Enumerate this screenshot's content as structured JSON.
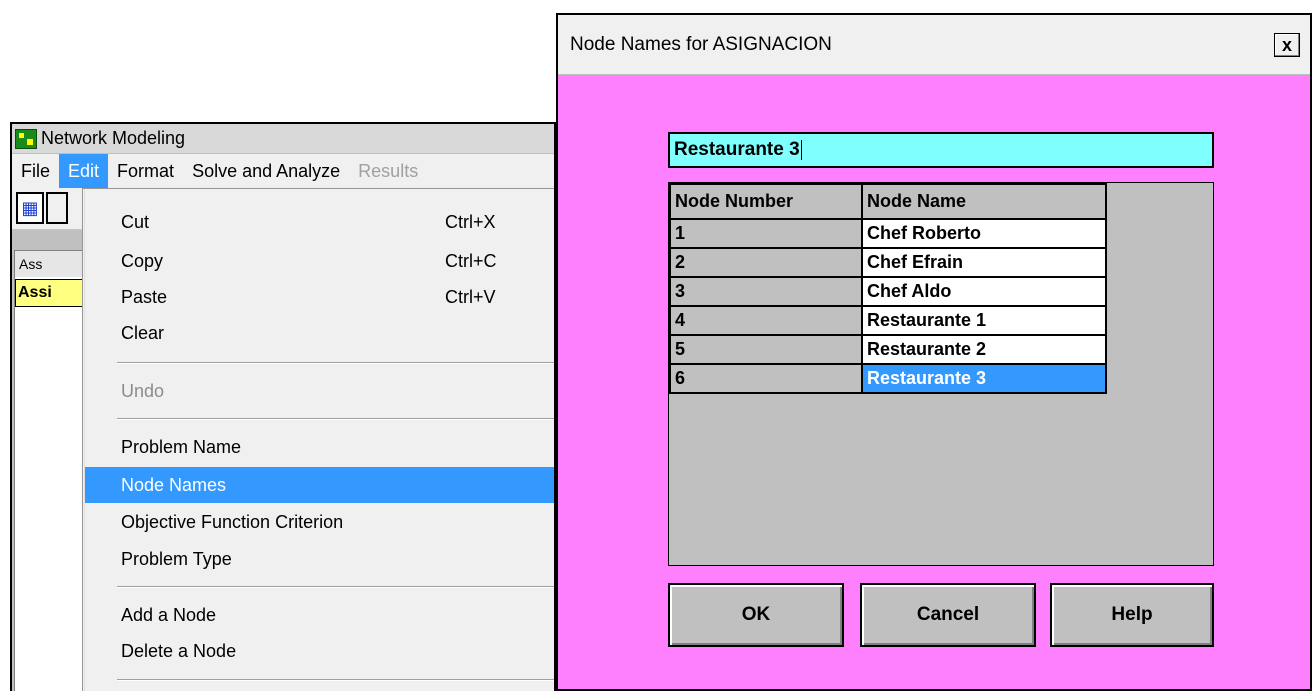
{
  "left_window": {
    "title": "Network Modeling",
    "menu": [
      "File",
      "Edit",
      "Format",
      "Solve and Analyze",
      "Results"
    ],
    "child_title": "Ass",
    "child_cell": "Assi"
  },
  "edit_menu": {
    "cut": {
      "label": "Cut",
      "shortcut": "Ctrl+X"
    },
    "copy": {
      "label": "Copy",
      "shortcut": "Ctrl+C"
    },
    "paste": {
      "label": "Paste",
      "shortcut": "Ctrl+V"
    },
    "clear": {
      "label": "Clear"
    },
    "undo": {
      "label": "Undo"
    },
    "problem_name": {
      "label": "Problem Name"
    },
    "node_names": {
      "label": "Node Names"
    },
    "objective": {
      "label": "Objective Function Criterion"
    },
    "problem_type": {
      "label": "Problem Type"
    },
    "add_node": {
      "label": "Add a Node"
    },
    "delete_node": {
      "label": "Delete a Node"
    }
  },
  "dialog": {
    "title": "Node Names for ASIGNACION",
    "close": "x",
    "edit_value": "Restaurante 3",
    "headers": {
      "number": "Node Number",
      "name": "Node Name"
    },
    "rows": [
      {
        "number": "1",
        "name": "Chef Roberto"
      },
      {
        "number": "2",
        "name": "Chef Efrain"
      },
      {
        "number": "3",
        "name": "Chef Aldo"
      },
      {
        "number": "4",
        "name": "Restaurante 1"
      },
      {
        "number": "5",
        "name": "Restaurante 2"
      },
      {
        "number": "6",
        "name": "Restaurante 3"
      }
    ],
    "buttons": {
      "ok": "OK",
      "cancel": "Cancel",
      "help": "Help"
    }
  },
  "colors": {
    "dialog_bg": "#ff80ff",
    "edit_bg": "#80ffff",
    "highlight": "#3399ff",
    "grid_bg": "#c0c0c0",
    "cell_bg": "#c0c0c0"
  }
}
